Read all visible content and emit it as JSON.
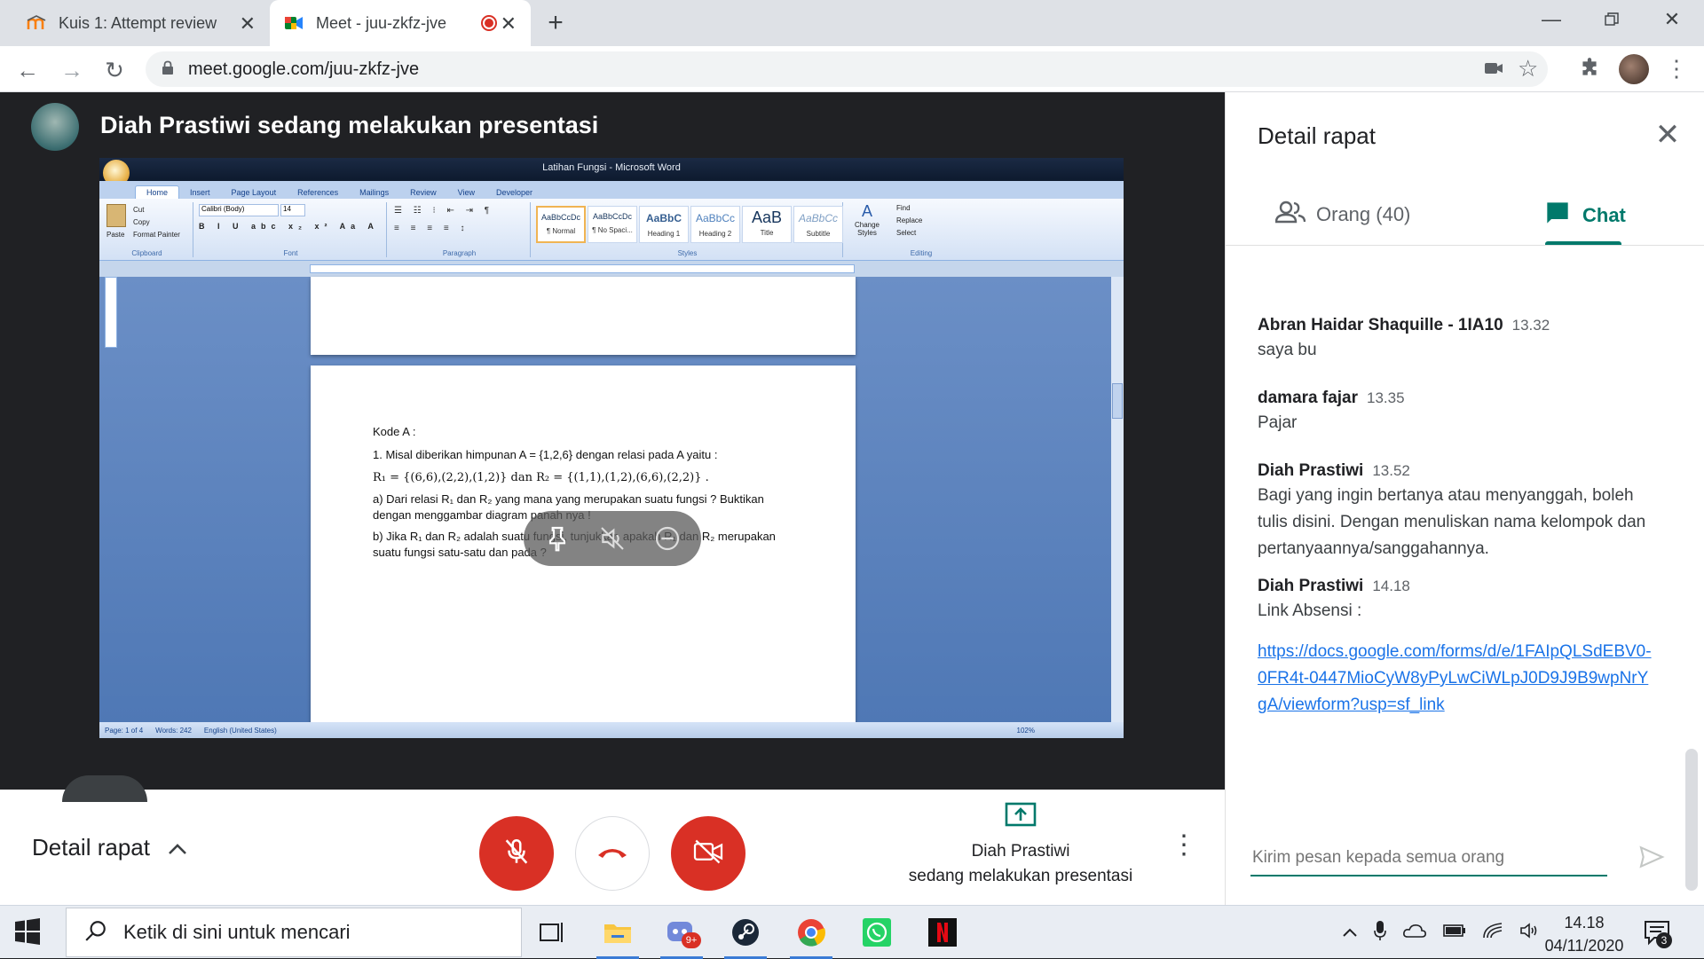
{
  "browser": {
    "tabs": [
      {
        "title": "Kuis 1: Attempt review",
        "favicon": "moodle-icon"
      },
      {
        "title": "Meet - juu-zkfz-jve",
        "favicon": "meet-icon",
        "recording": true
      }
    ],
    "url": "meet.google.com/juu-zkfz-jve"
  },
  "meet": {
    "presenter_banner": "Diah Prastiwi sedang melakukan presentasi",
    "word_window": {
      "title": "Latihan Fungsi - Microsoft Word",
      "tabs": [
        "Home",
        "Insert",
        "Page Layout",
        "References",
        "Mailings",
        "Review",
        "View",
        "Developer"
      ],
      "ribbon": {
        "clipboard": {
          "paste": "Paste",
          "cut": "Cut",
          "copy": "Copy",
          "format_painter": "Format Painter",
          "label": "Clipboard"
        },
        "font": {
          "name": "Calibri (Body)",
          "size": "14",
          "label": "Font"
        },
        "paragraph_label": "Paragraph",
        "styles": [
          {
            "preview": "AaBbCcDc",
            "name": "¶ Normal",
            "selected": true
          },
          {
            "preview": "AaBbCcDc",
            "name": "¶ No Spaci..."
          },
          {
            "preview": "AaBbC",
            "name": "Heading 1"
          },
          {
            "preview": "AaBbCc",
            "name": "Heading 2"
          },
          {
            "preview": "AaB",
            "name": "Title"
          },
          {
            "preview": "AaBbCc",
            "name": "Subtitle"
          }
        ],
        "change_styles": "Change Styles",
        "styles_label": "Styles",
        "editing": {
          "find": "Find",
          "replace": "Replace",
          "select": "Select",
          "label": "Editing"
        }
      },
      "document": {
        "kode": "Kode A :",
        "q1": "1. Misal diberikan himpunan A = {1,2,6} dengan relasi pada A yaitu :",
        "relations": "R₁ = {(6,6),(2,2),(1,2)} dan R₂ = {(1,1),(1,2),(6,6),(2,2)} .",
        "qa_1": "a) Dari relasi R₁ dan R₂ yang mana yang merupakan suatu fungsi ? Buktikan",
        "qa_2": "dengan menggambar diagram panah nya !",
        "qb_1": "b) Jika R₁ dan R₂ adalah suatu fungsi, tunjukkan apakah R₁ dan R₂ merupakan",
        "qb_2": "suatu fungsi satu-satu dan pada ?"
      },
      "status": {
        "page": "Page: 1 of 4",
        "words": "Words: 242",
        "language": "English (United States)",
        "zoom": "102%"
      }
    }
  },
  "controls": {
    "detail_label": "Detail rapat",
    "present_line1": "Diah Prastiwi",
    "present_line2": "sedang melakukan presentasi",
    "mic_muted": true,
    "camera_off": true,
    "danger_color": "#d93025"
  },
  "side_panel": {
    "title": "Detail rapat",
    "people_tab": "Orang (40)",
    "chat_tab": "Chat",
    "accent": "#00796b",
    "messages": [
      {
        "sender": "Abran Haidar Shaquille - 1IA10",
        "time": "13.32",
        "text": "saya bu"
      },
      {
        "sender": "damara fajar",
        "time": "13.35",
        "text": "Pajar"
      },
      {
        "sender": "Diah Prastiwi",
        "time": "13.52",
        "text": "Bagi yang ingin bertanya atau menyanggah, boleh tulis disini. Dengan menuliskan nama kelompok dan pertanyaannya/sanggahannya."
      },
      {
        "sender": "Diah Prastiwi",
        "time": "14.18",
        "text": "Link Absensi :",
        "link": "https://docs.google.com/forms/d/e/1FAIpQLSdEBV0-0FR4t-0447MioCyW8yPyLwCiWLpJ0D9J9B9wpNrYgA/viewform?usp=sf_link"
      }
    ],
    "input_placeholder": "Kirim pesan kepada semua orang"
  },
  "taskbar": {
    "search_placeholder": "Ketik di sini untuk mencari",
    "time": "14.18",
    "date": "04/11/2020",
    "notifications": "3",
    "discord_badge": "9+"
  }
}
